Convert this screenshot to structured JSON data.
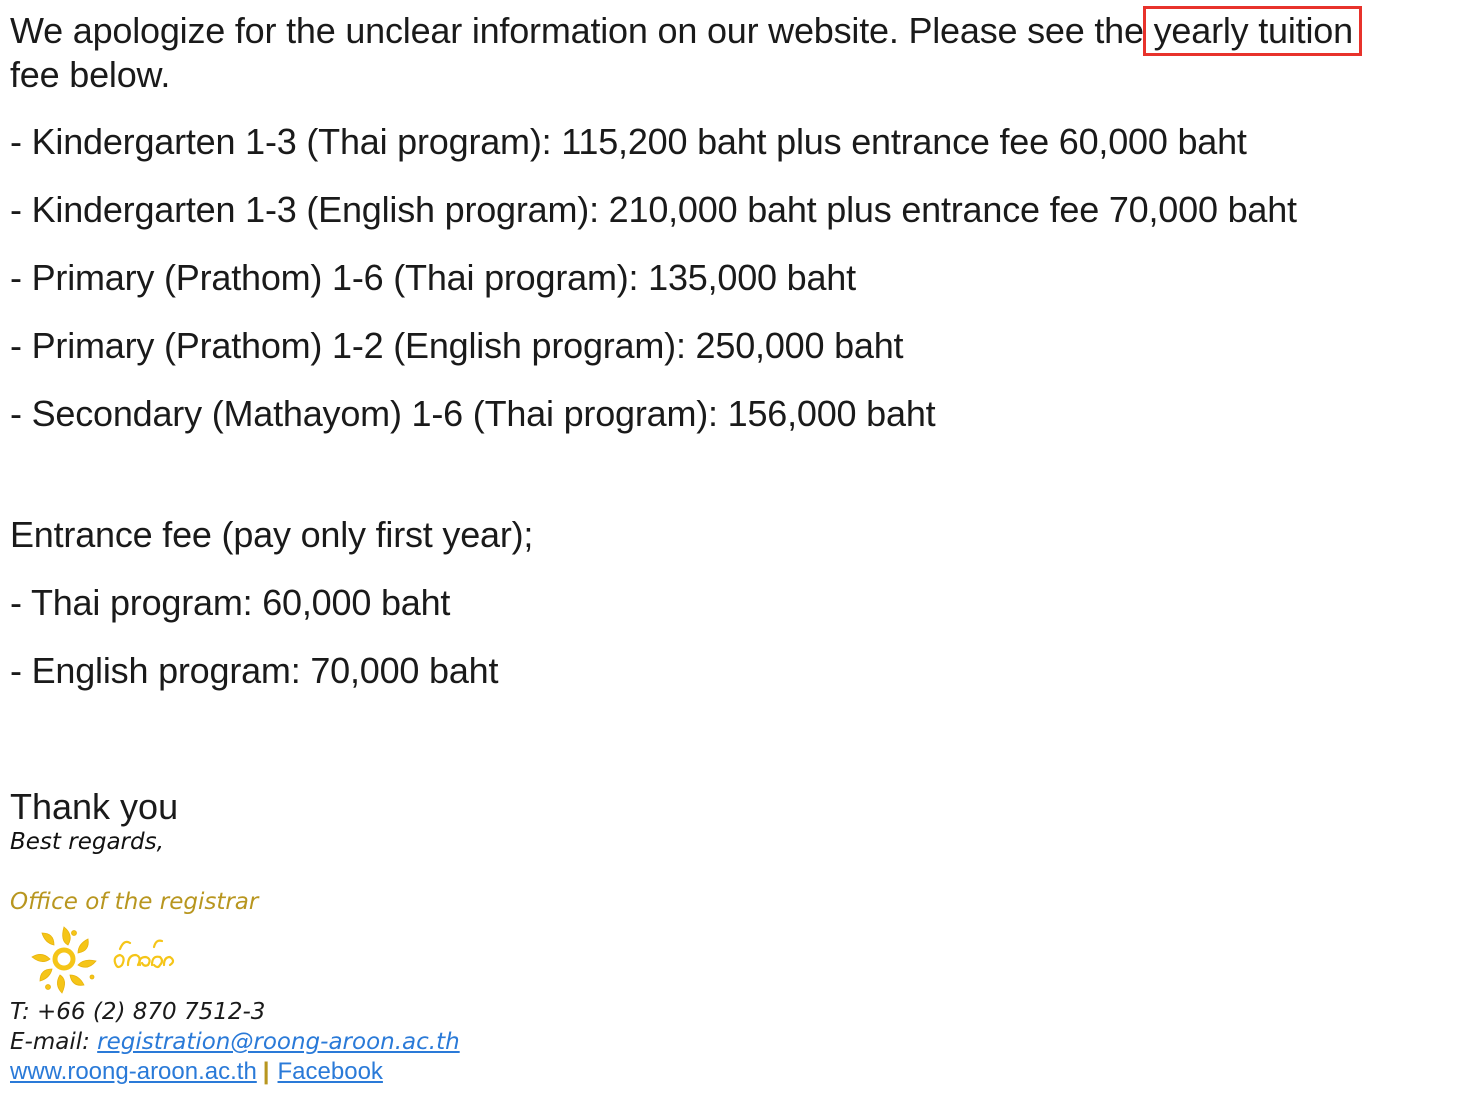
{
  "intro": {
    "before": "We apologize for the unclear information on our website. Please see the",
    "highlight": "yearly tuition",
    "after": "fee below."
  },
  "tuition_list": [
    "- Kindergarten 1-3 (Thai program): 115,200 baht plus entrance fee 60,000 baht",
    "- Kindergarten 1-3 (English program): 210,000 baht plus entrance fee 70,000 baht",
    "- Primary (Prathom) 1-6 (Thai program): 135,000 baht",
    "- Primary (Prathom) 1-2 (English program): 250,000 baht",
    "- Secondary (Mathayom) 1-6 (Thai program): 156,000 baht"
  ],
  "entrance": {
    "heading": "Entrance fee (pay only first year);",
    "items": [
      "- Thai program: 60,000 baht",
      "- English program: 70,000 baht"
    ]
  },
  "closing": {
    "thanks": "Thank you",
    "regards": "Best regards,",
    "office": "Office of the registrar"
  },
  "contact": {
    "phone": "T:  +66 (2) 870 7512-3",
    "email_label": "E-mail: ",
    "email": "registration@roong-aroon.ac.th",
    "website": "www.roong-aroon.ac.th",
    "separator": "|",
    "facebook": "Facebook "
  },
  "colors": {
    "highlight_box": "#e8322b",
    "link": "#2a7ad8",
    "office_gold": "#b8961f",
    "logo_yellow": "#f5c518"
  },
  "icons": {
    "logo": "school-sun-logo"
  }
}
